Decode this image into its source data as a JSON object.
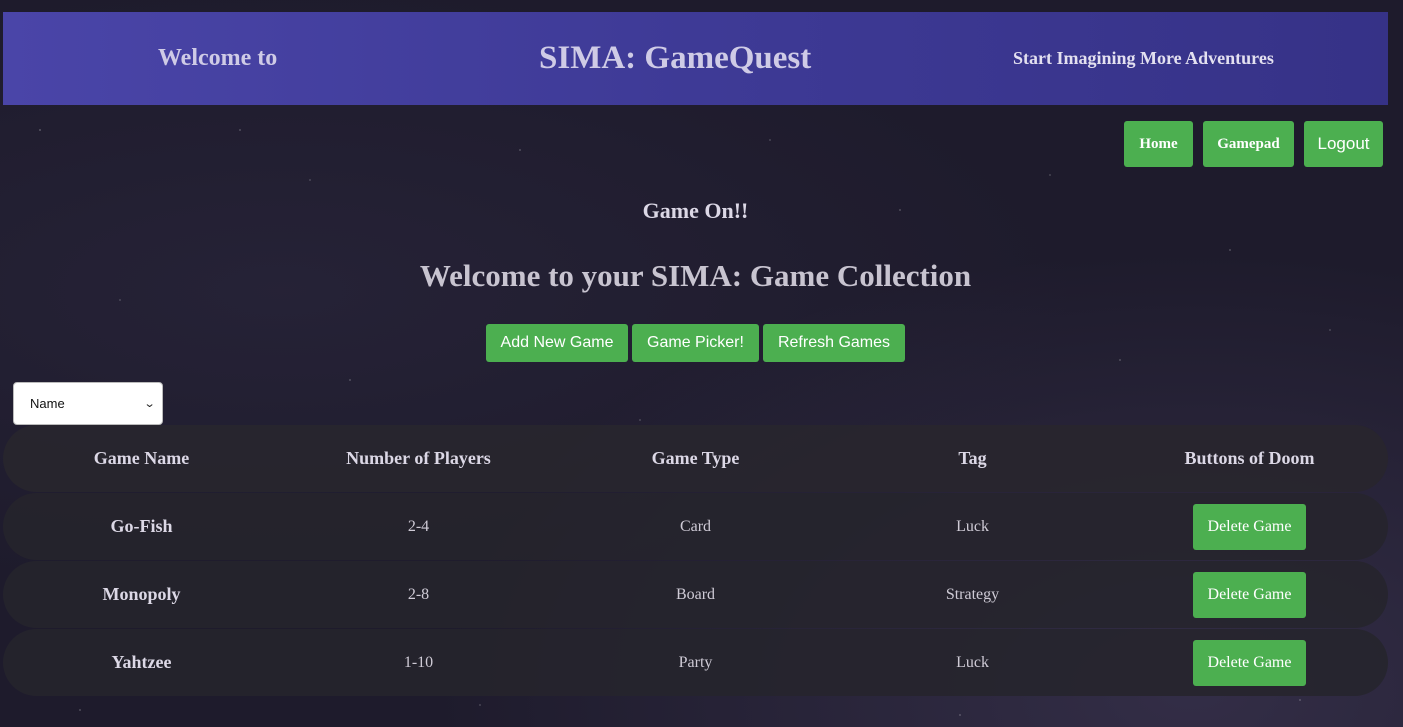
{
  "banner": {
    "welcome": "Welcome to",
    "title": "SIMA: GameQuest",
    "tagline": "Start Imagining More Adventures"
  },
  "nav": {
    "home": "Home",
    "gamepad": "Gamepad",
    "logout": "Logout"
  },
  "main": {
    "game_on": "Game On!!",
    "title": "Welcome to your SIMA: Game Collection",
    "actions": {
      "add": "Add New Game",
      "picker": "Game Picker!",
      "refresh": "Refresh Games"
    },
    "sort": {
      "selected": "Name"
    }
  },
  "table": {
    "headers": [
      "Game Name",
      "Number of Players",
      "Game Type",
      "Tag",
      "Buttons of Doom"
    ],
    "rows": [
      {
        "name": "Go-Fish",
        "players": "2-4",
        "type": "Card",
        "tag": "Luck",
        "action": "Delete Game"
      },
      {
        "name": "Monopoly",
        "players": "2-8",
        "type": "Board",
        "tag": "Strategy",
        "action": "Delete Game"
      },
      {
        "name": "Yahtzee",
        "players": "1-10",
        "type": "Party",
        "tag": "Luck",
        "action": "Delete Game"
      }
    ]
  },
  "colors": {
    "accent_button": "#4caf50",
    "banner": "#413d9c",
    "background": "#1e1b2c"
  },
  "icons": {
    "select_arrow": "chevron-down-icon"
  }
}
